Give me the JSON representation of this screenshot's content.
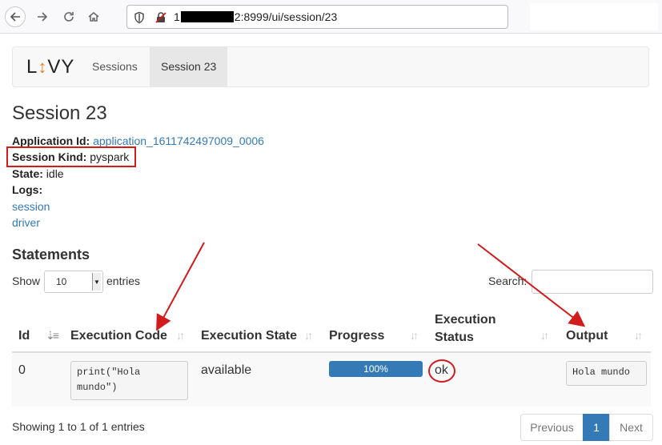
{
  "browser": {
    "url_prefix": "1",
    "url_suffix": "2:8999/ui/session/23"
  },
  "navbar": {
    "brand_left": "L",
    "brand_arrow": "↕",
    "brand_right": "VY",
    "items": [
      {
        "label": "Sessions"
      },
      {
        "label": "Session 23",
        "active": true
      }
    ]
  },
  "page": {
    "title": "Session 23",
    "application_id_label": "Application Id:",
    "application_id": "application_1611742497009_0006",
    "session_kind_label": "Session Kind:",
    "session_kind": "pyspark",
    "state_label": "State:",
    "state": "idle",
    "logs_label": "Logs:",
    "log_links": [
      "session",
      "driver"
    ]
  },
  "statements": {
    "title": "Statements",
    "length_show": "Show",
    "length_value": "10",
    "length_entries": "entries",
    "search_label": "Search:",
    "columns": [
      "Id",
      "Execution Code",
      "Execution State",
      "Progress",
      "Execution Status",
      "Output"
    ],
    "status_col_line1": "Execution",
    "status_col_line2": "Status",
    "rows": [
      {
        "id": "0",
        "code": "print(\"Hola\nmundo\")",
        "state": "available",
        "progress_label": "100%",
        "progress": 1.0,
        "status": "ok",
        "output": "Hola mundo"
      }
    ],
    "info": "Showing 1 to 1 of 1 entries",
    "pagination": {
      "previous": "Previous",
      "page": "1",
      "next": "Next"
    }
  },
  "colors": {
    "link": "#337ab7",
    "annotation_red": "#d21b1b",
    "brand_accent": "#e67e22"
  }
}
